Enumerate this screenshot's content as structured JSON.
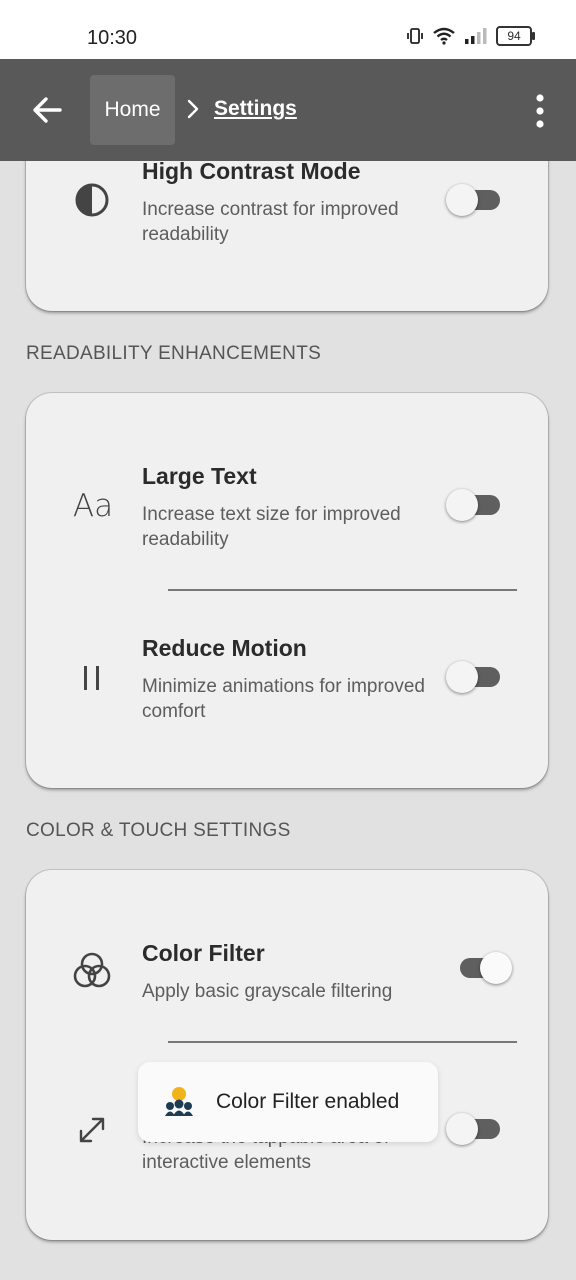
{
  "status_bar": {
    "time": "10:30",
    "battery": "94"
  },
  "app_bar": {
    "breadcrumb_home": "Home",
    "breadcrumb_current": "Settings"
  },
  "sections": {
    "top_card": {
      "high_contrast": {
        "title": "High Contrast Mode",
        "description": "Increase contrast for improved readability",
        "enabled": false,
        "icon": "contrast-icon"
      }
    },
    "readability": {
      "label": "READABILITY ENHANCEMENTS",
      "large_text": {
        "title": "Large Text",
        "description": "Increase text size for improved readability",
        "enabled": false,
        "icon": "text-size-icon"
      },
      "reduce_motion": {
        "title": "Reduce Motion",
        "description": "Minimize animations for improved comfort",
        "enabled": false,
        "icon": "pause-icon"
      }
    },
    "color_touch": {
      "label": "COLOR & TOUCH SETTINGS",
      "color_filter": {
        "title": "Color Filter",
        "description": "Apply basic grayscale filtering",
        "enabled": true,
        "icon": "color-filter-icon"
      },
      "touch_target": {
        "description": "Increase the tappable area of interactive elements",
        "enabled": false,
        "icon": "expand-icon"
      }
    }
  },
  "toast": {
    "message": "Color Filter enabled"
  }
}
